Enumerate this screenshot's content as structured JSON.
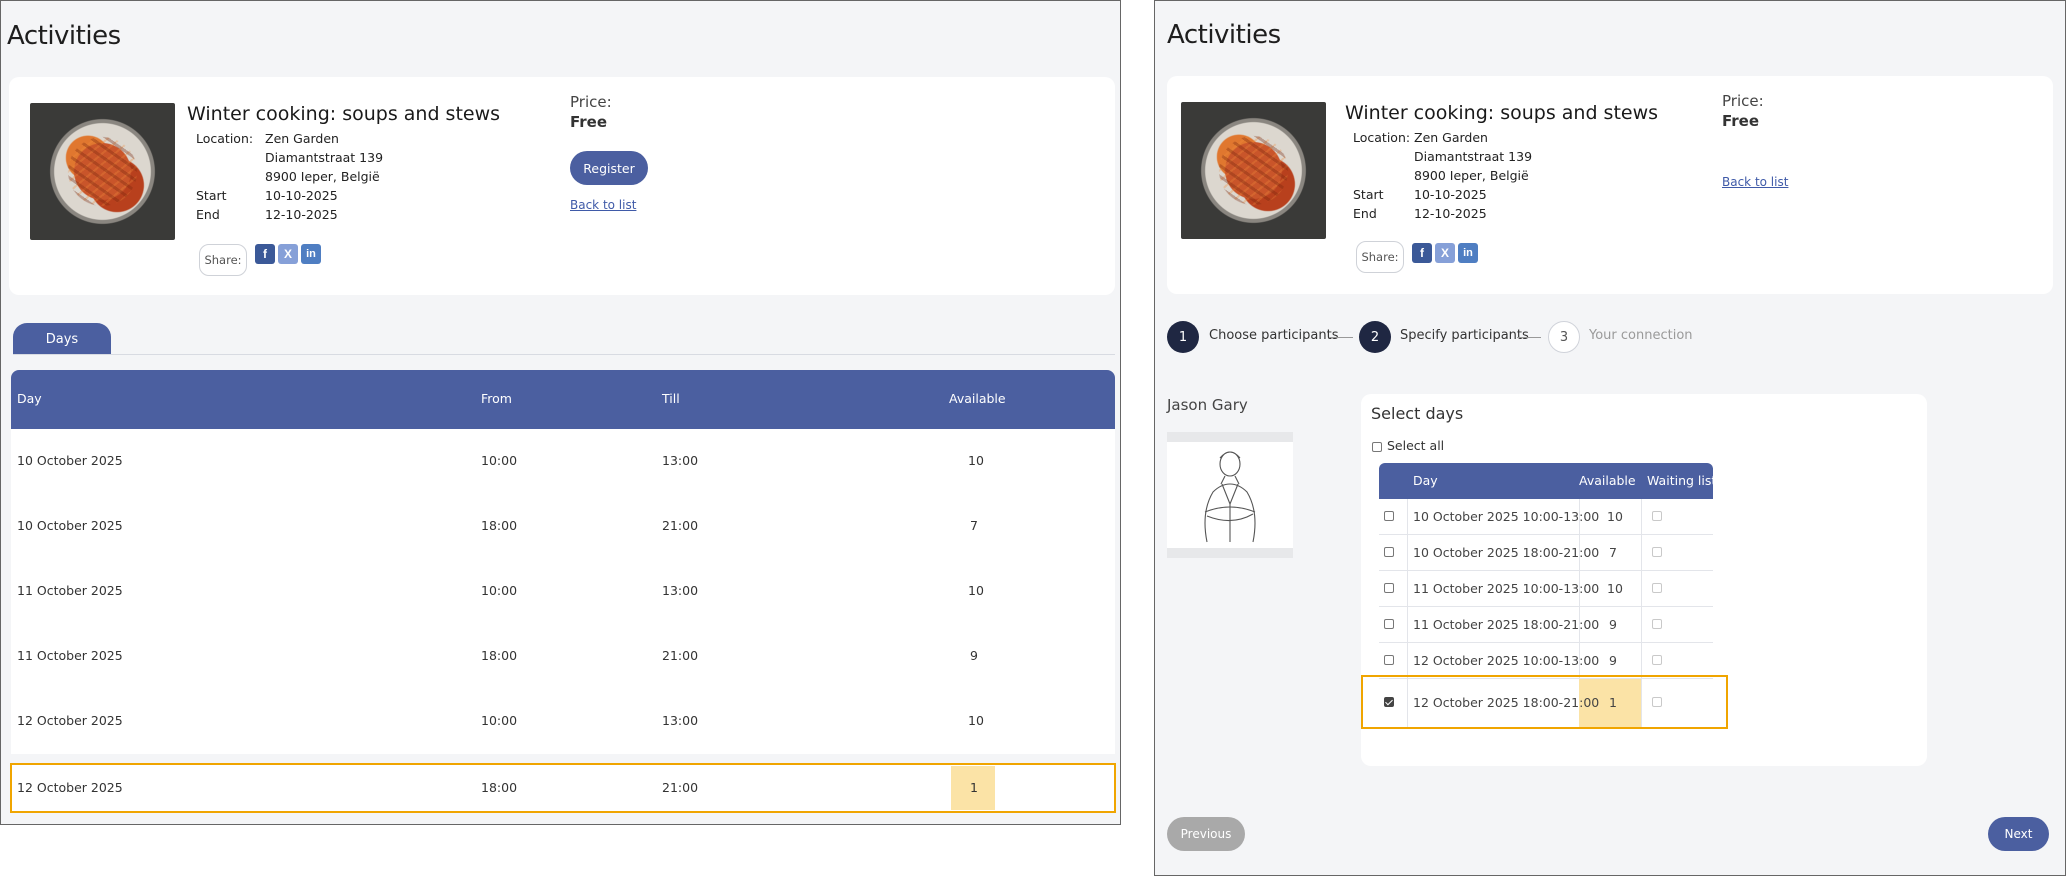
{
  "colors": {
    "primary": "#4b5fa0",
    "highlight": "#f0a500",
    "highlight_fill": "#fbe3a6",
    "dark_step": "#1f2742"
  },
  "left": {
    "page_title": "Activities",
    "activity": {
      "title": "Winter cooking: soups and stews",
      "location_label": "Location:",
      "location_lines": [
        "Zen Garden",
        "Diamantstraat 139",
        "8900 Ieper, België"
      ],
      "start_label": "Start",
      "start_value": "10-10-2025",
      "end_label": "End",
      "end_value": "12-10-2025",
      "share_label": "Share:",
      "social": [
        "f",
        "X",
        "in"
      ],
      "price_label": "Price:",
      "price_value": "Free",
      "register_label": "Register",
      "back_link": "Back to list",
      "image_icon": "spaghetti-photo"
    },
    "tab_label": "Days",
    "table": {
      "headers": [
        "Day",
        "From",
        "Till",
        "Available"
      ],
      "rows": [
        [
          "10 October 2025",
          "10:00",
          "13:00",
          "10"
        ],
        [
          "10 October 2025",
          "18:00",
          "21:00",
          "7"
        ],
        [
          "11 October 2025",
          "10:00",
          "13:00",
          "10"
        ],
        [
          "11 October 2025",
          "18:00",
          "21:00",
          "9"
        ],
        [
          "12 October 2025",
          "10:00",
          "13:00",
          "10"
        ],
        [
          "12 October 2025",
          "18:00",
          "21:00",
          "1"
        ]
      ]
    }
  },
  "right": {
    "page_title": "Activities",
    "activity": {
      "title": "Winter cooking: soups and stews",
      "location_label": "Location:",
      "location_lines": [
        "Zen Garden",
        "Diamantstraat 139",
        "8900 Ieper, België"
      ],
      "start_label": "Start",
      "start_value": "10-10-2025",
      "end_label": "End",
      "end_value": "12-10-2025",
      "share_label": "Share:",
      "social": [
        "f",
        "X",
        "in"
      ],
      "price_label": "Price:",
      "price_value": "Free",
      "back_link": "Back to list"
    },
    "steps": [
      {
        "num": "1",
        "label": "Choose participants"
      },
      {
        "num": "2",
        "label": "Specify participants"
      },
      {
        "num": "3",
        "label": "Your connection"
      }
    ],
    "participant_name": "Jason Gary",
    "select_days_title": "Select days",
    "select_all_label": "Select all",
    "mini_table": {
      "headers": [
        "Day",
        "Available",
        "Waiting list"
      ],
      "rows": [
        [
          "10 October 2025 10:00-13:00",
          "10"
        ],
        [
          "10 October 2025 18:00-21:00",
          "7"
        ],
        [
          "11 October 2025 10:00-13:00",
          "10"
        ],
        [
          "11 October 2025 18:00-21:00",
          "9"
        ],
        [
          "12 October 2025 10:00-13:00",
          "9"
        ],
        [
          "12 October 2025 18:00-21:00",
          "1"
        ]
      ]
    },
    "prev_label": "Previous",
    "next_label": "Next"
  }
}
